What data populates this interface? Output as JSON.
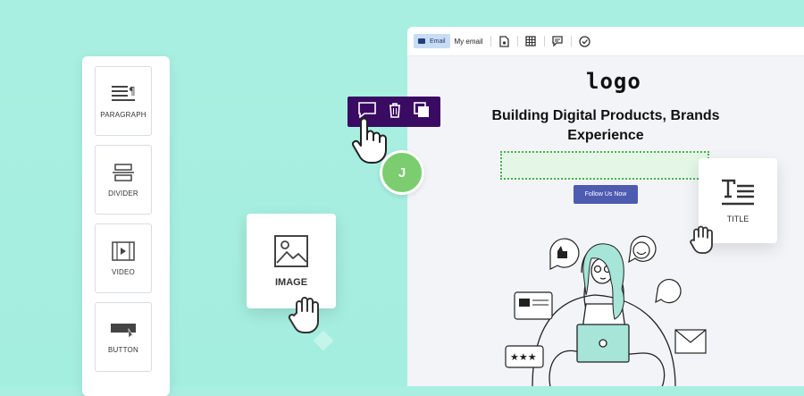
{
  "palette": {
    "items": [
      {
        "label": "PARAGRAPH",
        "icon": "paragraph-icon"
      },
      {
        "label": "DIVIDER",
        "icon": "divider-icon"
      },
      {
        "label": "VIDEO",
        "icon": "video-icon"
      },
      {
        "label": "BUTTON",
        "icon": "button-icon"
      }
    ]
  },
  "drag_card": {
    "label": "IMAGE",
    "icon": "image-icon"
  },
  "editor": {
    "tag": "Email",
    "email_name": "My email",
    "toolbar_icons": [
      "document-icon",
      "grid-icon",
      "comment-icon",
      "check-circle-icon"
    ],
    "logo": "logo",
    "headline": "Building Digital Products, Brands Experience",
    "follow_button": "Follow Us Now"
  },
  "popup": {
    "icons": [
      "comment-icon",
      "trash-icon",
      "duplicate-icon"
    ]
  },
  "avatar": {
    "initial": "J",
    "color": "#7bcd6f"
  },
  "title_card": {
    "label": "TITLE",
    "icon": "title-icon"
  },
  "colors": {
    "background": "#a9efe1",
    "popup": "#3a0b63",
    "button": "#4d5bb0"
  }
}
